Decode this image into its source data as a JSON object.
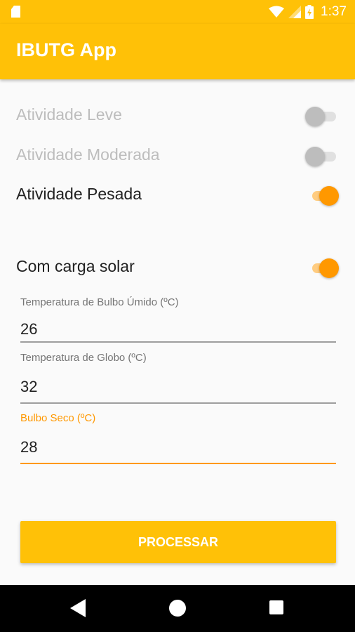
{
  "status_bar": {
    "time": "1:37"
  },
  "app_bar": {
    "title": "IBUTG App"
  },
  "activities": [
    {
      "label": "Atividade Leve",
      "checked": false
    },
    {
      "label": "Atividade Moderada",
      "checked": false
    },
    {
      "label": "Atividade Pesada",
      "checked": true
    }
  ],
  "solar": {
    "label": "Com carga solar",
    "checked": true
  },
  "fields": [
    {
      "label": "Temperatura de Bulbo Úmido (ºC)",
      "value": "26",
      "focused": false
    },
    {
      "label": "Temperatura de Globo (ºC)",
      "value": "32",
      "focused": false
    },
    {
      "label": "Bulbo Seco (ºC)",
      "value": "28",
      "focused": true
    }
  ],
  "button": {
    "label": "PROCESSAR"
  },
  "colors": {
    "primary": "#ffc107",
    "accent": "#ff9800",
    "text": "#212121",
    "disabled": "#bdbdbd"
  }
}
